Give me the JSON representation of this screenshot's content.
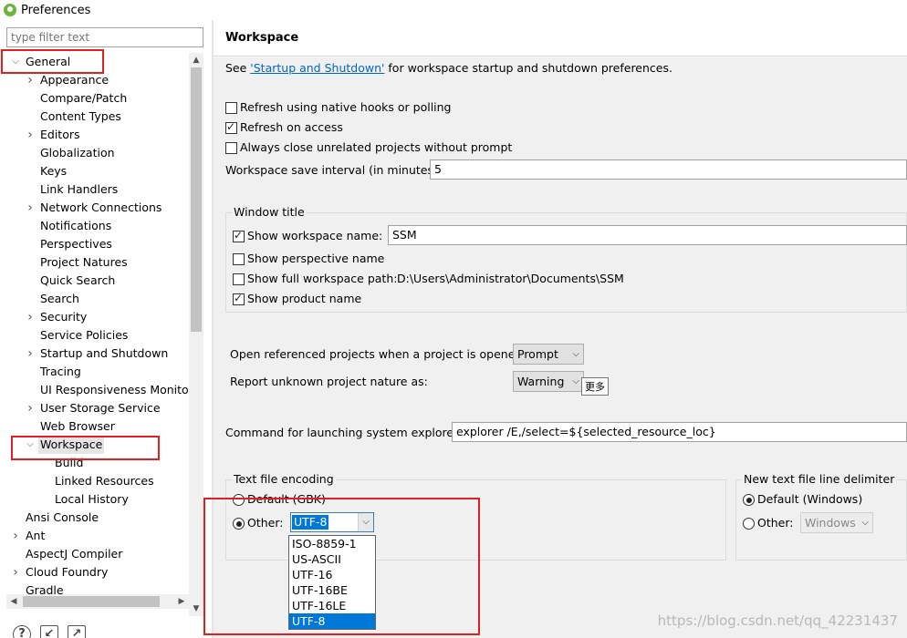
{
  "window": {
    "title": "Preferences"
  },
  "filter": {
    "placeholder": "type filter text"
  },
  "tree": {
    "items": [
      {
        "label": "General",
        "expanded": true,
        "level": 0
      },
      {
        "label": "Appearance",
        "expandable": true,
        "level": 1
      },
      {
        "label": "Compare/Patch",
        "level": 1
      },
      {
        "label": "Content Types",
        "level": 1
      },
      {
        "label": "Editors",
        "expandable": true,
        "level": 1
      },
      {
        "label": "Globalization",
        "level": 1
      },
      {
        "label": "Keys",
        "level": 1
      },
      {
        "label": "Link Handlers",
        "level": 1
      },
      {
        "label": "Network Connections",
        "expandable": true,
        "level": 1
      },
      {
        "label": "Notifications",
        "level": 1
      },
      {
        "label": "Perspectives",
        "level": 1
      },
      {
        "label": "Project Natures",
        "level": 1
      },
      {
        "label": "Quick Search",
        "level": 1
      },
      {
        "label": "Search",
        "level": 1
      },
      {
        "label": "Security",
        "expandable": true,
        "level": 1
      },
      {
        "label": "Service Policies",
        "level": 1
      },
      {
        "label": "Startup and Shutdown",
        "expandable": true,
        "level": 1
      },
      {
        "label": "Tracing",
        "level": 1
      },
      {
        "label": "UI Responsiveness Monitori",
        "level": 1
      },
      {
        "label": "User Storage Service",
        "expandable": true,
        "level": 1
      },
      {
        "label": "Web Browser",
        "level": 1
      },
      {
        "label": "Workspace",
        "expanded": true,
        "selected": true,
        "level": 1
      },
      {
        "label": "Build",
        "level": 2
      },
      {
        "label": "Linked Resources",
        "level": 2
      },
      {
        "label": "Local History",
        "level": 2
      },
      {
        "label": "Ansi Console",
        "level": 0
      },
      {
        "label": "Ant",
        "expandable": true,
        "level": 0
      },
      {
        "label": "AspectJ Compiler",
        "level": 0
      },
      {
        "label": "Cloud Foundry",
        "expandable": true,
        "level": 0
      },
      {
        "label": "Gradle",
        "level": 0
      }
    ]
  },
  "page": {
    "title": "Workspace",
    "see_prefix": "See ",
    "see_link": "'Startup and Shutdown'",
    "see_suffix": " for workspace startup and shutdown preferences.",
    "options": [
      {
        "label": "Refresh using native hooks or polling",
        "checked": false
      },
      {
        "label": "Refresh on access",
        "checked": true
      },
      {
        "label": "Always close unrelated projects without prompt",
        "checked": false
      }
    ],
    "save_interval_label": "Workspace save interval (in minutes):",
    "save_interval_value": "5",
    "window_title": {
      "group_label": "Window title",
      "show_workspace_name_label": "Show workspace name:",
      "show_workspace_name_checked": true,
      "workspace_name_value": "SSM",
      "show_perspective_label": "Show perspective name",
      "show_perspective_checked": false,
      "show_full_path_label": "Show full workspace path:",
      "show_full_path_checked": false,
      "full_path_value": "D:\\Users\\Administrator\\Documents\\SSM",
      "show_product_label": "Show product name",
      "show_product_checked": true
    },
    "open_referenced_label": "Open referenced projects when a project is opened:",
    "open_referenced_value": "Prompt",
    "report_unknown_label": "Report unknown project nature as:",
    "report_unknown_value": "Warning",
    "tooltip": "更多",
    "explorer_label": "Command for launching system explorer:",
    "explorer_value": "explorer /E,/select=${selected_resource_loc}",
    "encoding": {
      "group_label": "Text file encoding",
      "default_label": "Default (GBK)",
      "default_selected": false,
      "other_label": "Other:",
      "other_selected": true,
      "value": "UTF-8",
      "options": [
        "ISO-8859-1",
        "US-ASCII",
        "UTF-16",
        "UTF-16BE",
        "UTF-16LE",
        "UTF-8"
      ],
      "selected_option": "UTF-8"
    },
    "line_delimiter": {
      "group_label": "New text file line delimiter",
      "default_label": "Default (Windows)",
      "default_selected": true,
      "other_label": "Other:",
      "other_selected": false,
      "other_value": "Windows"
    }
  },
  "watermark": "https://blog.csdn.net/qq_42231437",
  "colors": {
    "highlight": "#e02020",
    "selection": "#0078d7",
    "link": "#0066cc"
  },
  "icons": [
    "spring-leaf-icon",
    "help-icon",
    "import-icon",
    "export-icon",
    "chevron-down-icon",
    "chevron-right-icon"
  ]
}
